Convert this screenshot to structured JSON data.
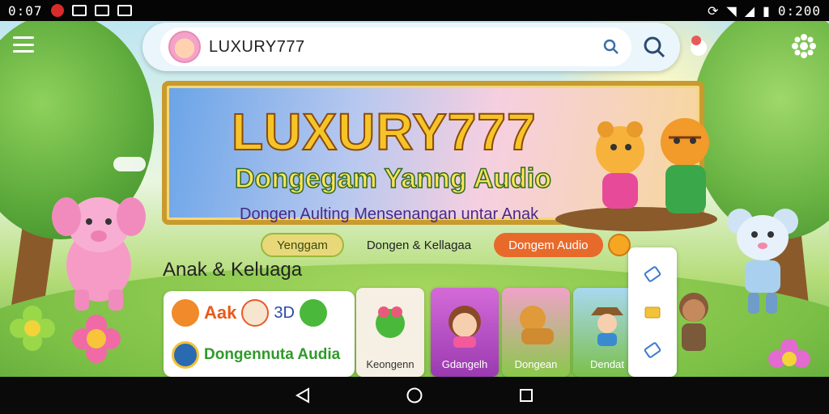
{
  "status_bar": {
    "time_left": "0:07",
    "time_right": "0:200"
  },
  "search": {
    "value": "LUXURY777"
  },
  "banner": {
    "title": "LUXURY777",
    "subtitle": "Dongegam Yanng Audio",
    "tagline": "Dongen Aulting Mensenangan untar Anak"
  },
  "chips": [
    {
      "label": "Yenggam"
    },
    {
      "label": "Dongen & Kellagaa"
    },
    {
      "label": "Dongem Audio"
    }
  ],
  "section": {
    "title": "Anak & Keluaga"
  },
  "large_card": {
    "row1_text": "Aak",
    "row1_suffix": "3D",
    "row2_text": "Dongennuta Audia"
  },
  "cards": [
    {
      "label": "Keongenn"
    },
    {
      "label": "Gdangelh"
    },
    {
      "label": "Dongean"
    },
    {
      "label": "Dendat"
    }
  ],
  "colors": {
    "banner_title": "#f6c428",
    "chip_orange": "#e86a2a",
    "chip_green": "#e8d87a"
  }
}
